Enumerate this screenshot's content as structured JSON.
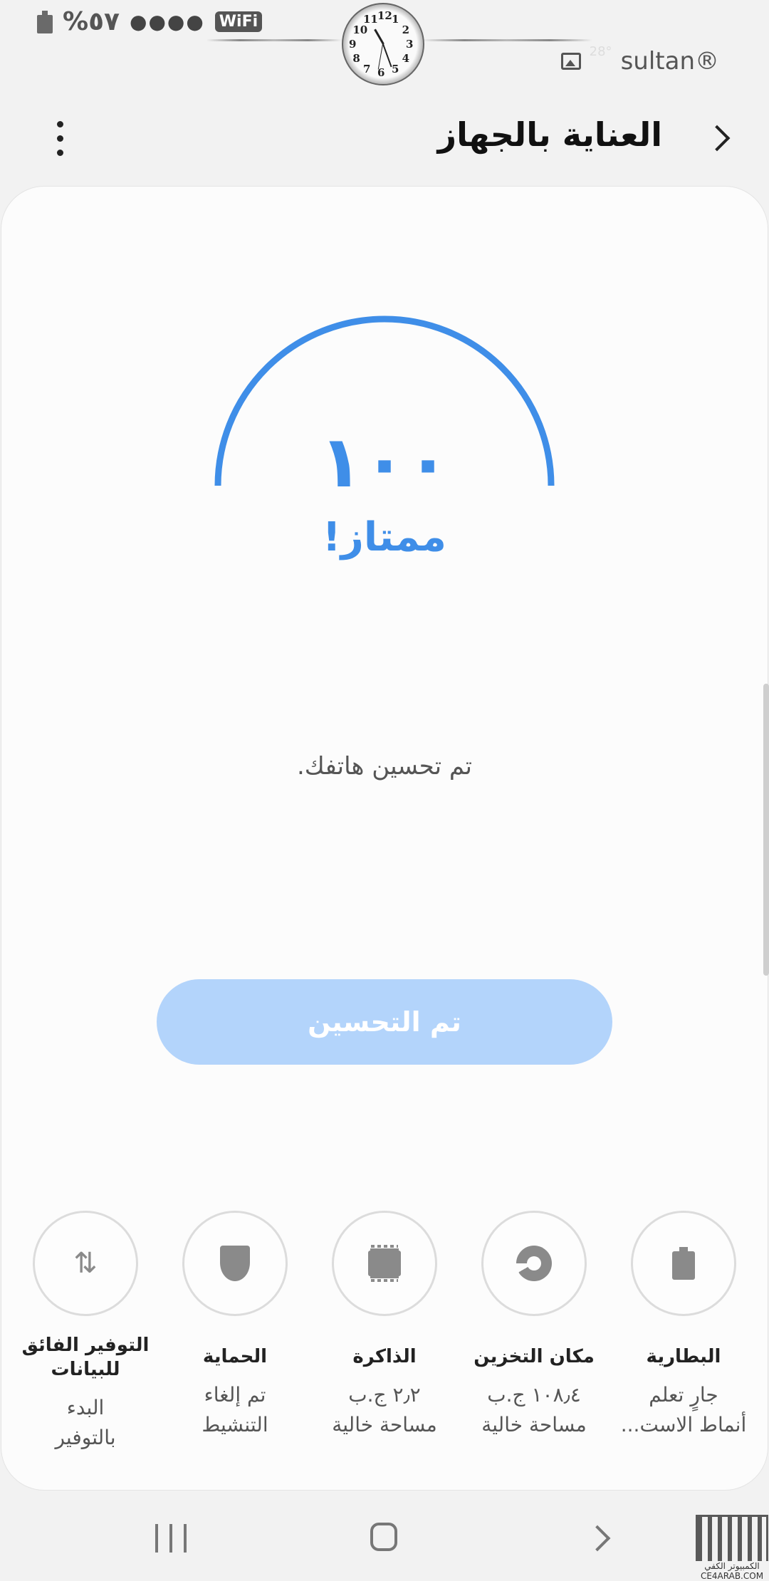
{
  "status_bar": {
    "battery_percent": "%٥٧",
    "signal": "●●●●",
    "wifi_label": "WiFi",
    "temperature": "28°",
    "carrier": "sultan®",
    "clock_numbers": [
      "12",
      "1",
      "2",
      "3",
      "4",
      "5",
      "6",
      "7",
      "8",
      "9",
      "10",
      "11"
    ]
  },
  "header": {
    "title": "العناية بالجهاز",
    "back_icon": "chevron-back-icon",
    "more_icon": "more-vert-icon"
  },
  "score": {
    "value": "١٠٠",
    "label": "ممتاز!",
    "gauge_fraction": 1.0,
    "accent_color": "#3f8ee8"
  },
  "message": "تم تحسين هاتفك.",
  "optimize_button": {
    "label": "تم التحسين",
    "color": "#b3d4fb"
  },
  "features": [
    {
      "name": "البطارية",
      "status_line1": "جارٍ تعلم",
      "status_line2": "أنماط الاست...",
      "icon": "battery-icon"
    },
    {
      "name": "مكان التخزين",
      "status_line1": "١٠٨٫٤ ج.ب",
      "status_line2": "مساحة خالية",
      "icon": "storage-icon"
    },
    {
      "name": "الذاكرة",
      "status_line1": "٢٫٢ ج.ب",
      "status_line2": "مساحة خالية",
      "icon": "memory-icon"
    },
    {
      "name": "الحماية",
      "status_line1": "تم إلغاء",
      "status_line2": "التنشيط",
      "icon": "shield-icon"
    },
    {
      "name_line1": "التوفير الفائق",
      "name_line2": "للبيانات",
      "status_line1": "البدء",
      "status_line2": "بالتوفير",
      "icon": "data-saver-icon"
    }
  ],
  "nav": {
    "recents_icon": "recents-icon",
    "home_icon": "home-icon",
    "back_icon": "back-icon"
  },
  "watermark": {
    "site": "CE4ARAB.COM",
    "name": "الكمبيوتر الكفي"
  }
}
